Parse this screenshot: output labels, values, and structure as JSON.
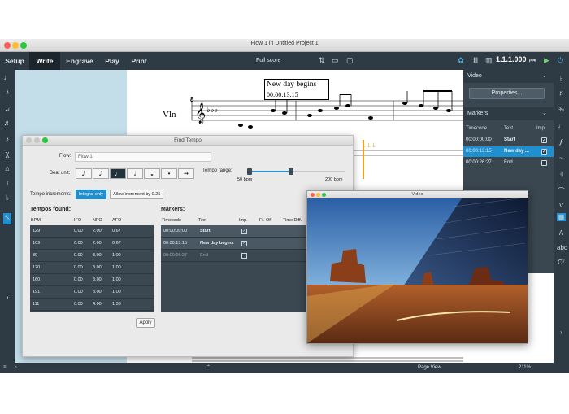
{
  "window": {
    "title": "Flow 1 in Untitled Project 1"
  },
  "toolbar": {
    "tabs": [
      "Setup",
      "Write",
      "Engrave",
      "Play",
      "Print"
    ],
    "active_tab": "Write",
    "score_select": "Full score",
    "timecode": "1.1.1.000"
  },
  "score": {
    "bar_number": "8",
    "instrument": "Vln",
    "marker_title": "New day begins",
    "marker_time": "00:00:13:15"
  },
  "video_panel": {
    "header": "Video",
    "properties_label": "Properties...",
    "markers_header": "Markers",
    "columns": [
      "Timecode",
      "Text",
      "Imp."
    ],
    "rows": [
      {
        "timecode": "00:00:00:00",
        "text": "Start",
        "imp": true,
        "selected": false
      },
      {
        "timecode": "00:00:13:15",
        "text": "New day ...",
        "imp": true,
        "selected": true
      },
      {
        "timecode": "00:00:26:27",
        "text": "End",
        "imp": false,
        "selected": false
      }
    ]
  },
  "find_tempo": {
    "title": "Find Tempo",
    "flow_label": "Flow:",
    "flow_value": "Flow 1",
    "beat_unit_label": "Beat unit:",
    "tempo_range_label": "Tempo range:",
    "tempo_min": "50 bpm",
    "tempo_max": "200 bpm",
    "increments_label": "Tempo increments:",
    "increment_options": [
      "Integral only",
      "Allow increment by 0.25"
    ],
    "tempos_found_label": "Tempos found:",
    "tempo_columns": [
      "BPM",
      "IFO",
      "NFO",
      "AFO"
    ],
    "tempo_rows": [
      [
        "129",
        "0.00",
        "2.00",
        "0.67"
      ],
      [
        "169",
        "0.00",
        "2.00",
        "0.67"
      ],
      [
        "80",
        "0.00",
        "3.00",
        "1.00"
      ],
      [
        "120",
        "0.00",
        "3.00",
        "1.00"
      ],
      [
        "160",
        "0.00",
        "3.00",
        "1.00"
      ],
      [
        "191",
        "0.00",
        "3.00",
        "1.00"
      ],
      [
        "111",
        "0.00",
        "4.00",
        "1.33"
      ]
    ],
    "markers_label": "Markers:",
    "marker_columns": [
      "Timecode",
      "Text",
      "Imp.",
      "Fr. Off",
      "Time Diff."
    ],
    "marker_rows": [
      {
        "timecode": "00:00:00:00",
        "text": "Start",
        "imp": true
      },
      {
        "timecode": "00:00:13:15",
        "text": "New day begins",
        "imp": true
      },
      {
        "timecode": "00:00:26:27",
        "text": "End",
        "imp": false
      }
    ],
    "apply_label": "Apply"
  },
  "video_window": {
    "title": "Video"
  },
  "statusbar": {
    "view": "Page View",
    "zoom": "211%"
  },
  "colors": {
    "accent": "#1f8fd0",
    "dark_panel": "#2e3a44",
    "score_blue": "#c3dde9"
  }
}
